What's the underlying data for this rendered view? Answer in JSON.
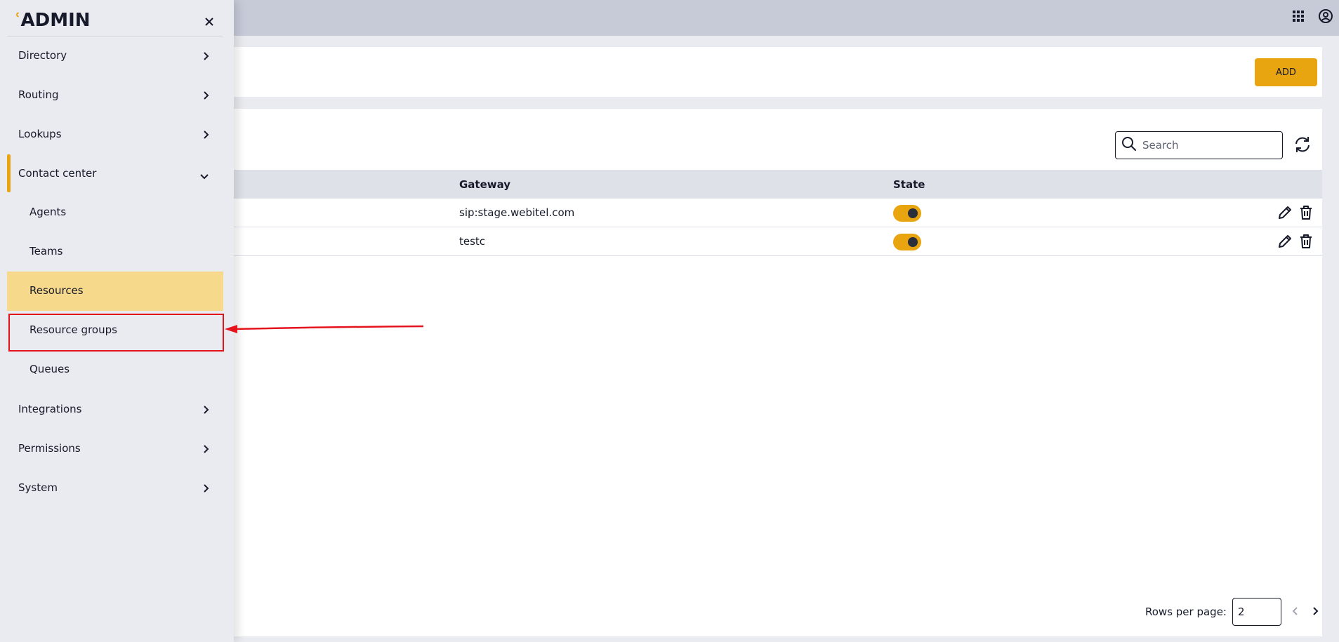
{
  "app": {
    "logo_mark": "ʿ",
    "logo_text": "ADMIN"
  },
  "header": {
    "apps_icon": "grid-icon",
    "account_icon": "account-circle-icon"
  },
  "sidebar": {
    "items": [
      {
        "label": "Directory",
        "icon": "chevron-right-icon"
      },
      {
        "label": "Routing",
        "icon": "chevron-right-icon"
      },
      {
        "label": "Lookups",
        "icon": "chevron-right-icon"
      },
      {
        "label": "Contact center",
        "icon": "chevron-down-icon",
        "expanded": true
      },
      {
        "label": "Integrations",
        "icon": "chevron-right-icon"
      },
      {
        "label": "Permissions",
        "icon": "chevron-right-icon"
      },
      {
        "label": "System",
        "icon": "chevron-right-icon"
      }
    ],
    "subitems": [
      {
        "label": "Agents"
      },
      {
        "label": "Teams"
      },
      {
        "label": "Resources",
        "selected": true
      },
      {
        "label": "Resource groups",
        "highlighted": true
      },
      {
        "label": "Queues"
      }
    ]
  },
  "toolbar": {
    "add_label": "ADD"
  },
  "search": {
    "placeholder": "Search"
  },
  "table": {
    "columns": [
      "Gateway",
      "State"
    ],
    "rows": [
      {
        "gateway": "sip:stage.webitel.com",
        "state": true
      },
      {
        "gateway": "testc",
        "state": true
      }
    ]
  },
  "pagination": {
    "rows_per_page_label": "Rows per page:",
    "rows_per_page_value": "2"
  },
  "colors": {
    "accent": "#e8a50f",
    "selected": "#f7d98b",
    "annotation": "#e5131b"
  }
}
